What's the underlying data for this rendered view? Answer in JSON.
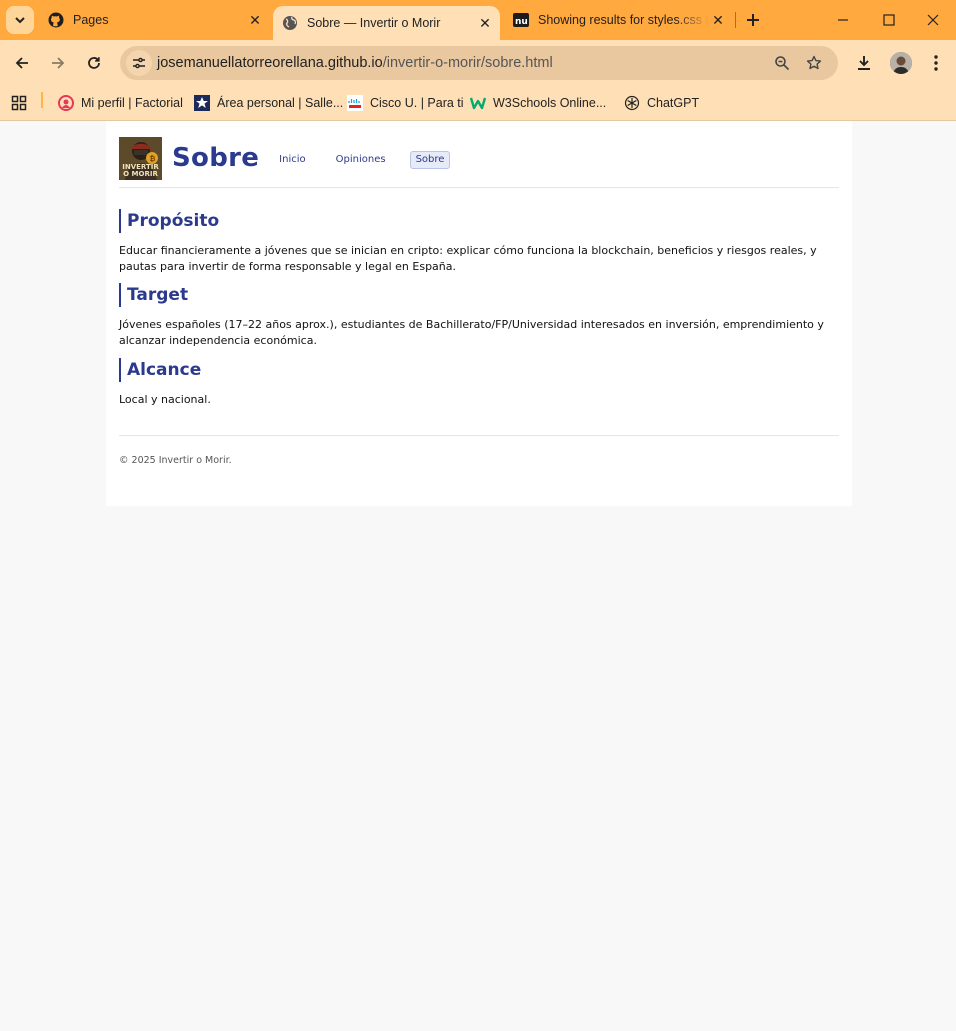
{
  "browser": {
    "tabs": [
      {
        "title": "Pages",
        "icon": "github-icon"
      },
      {
        "title": "Sobre — Invertir o Morir",
        "icon": "globe-icon",
        "active": true
      },
      {
        "title": "Showing results for styles.css (",
        "icon": "validator-icon"
      }
    ],
    "address": {
      "host": "josemanuellatorreorellana.github.io",
      "path": "/invertir-o-morir/sobre.html"
    },
    "bookmarks": [
      {
        "label": "Mi perfil | Factorial",
        "icon": "factorial-icon"
      },
      {
        "label": "Área personal | Salle...",
        "icon": "salle-icon"
      },
      {
        "label": "Cisco U. | Para ti",
        "icon": "cisco-icon"
      },
      {
        "label": "W3Schools Online...",
        "icon": "w3schools-icon"
      },
      {
        "label": "ChatGPT",
        "icon": "chatgpt-icon"
      }
    ],
    "accent": "#ffa93e"
  },
  "page": {
    "logo_text": [
      "INVERTIR",
      "O MORIR"
    ],
    "title": "Sobre",
    "nav": [
      {
        "label": "Inicio"
      },
      {
        "label": "Opiniones"
      },
      {
        "label": "Sobre",
        "active": true
      }
    ],
    "sections": [
      {
        "heading": "Propósito",
        "body": "Educar financieramente a jóvenes que se inician en cripto: explicar cómo funciona la blockchain, beneficios y riesgos reales, y pautas para invertir de forma responsable y legal en España."
      },
      {
        "heading": "Target",
        "body": "Jóvenes españoles (17–22 años aprox.), estudiantes de Bachillerato/FP/Universidad interesados en inversión, emprendimiento y alcanzar independencia económica."
      },
      {
        "heading": "Alcance",
        "body": "Local y nacional."
      }
    ],
    "footer": "© 2025 Invertir o Morir.",
    "brand_color": "#2b3a8e"
  }
}
